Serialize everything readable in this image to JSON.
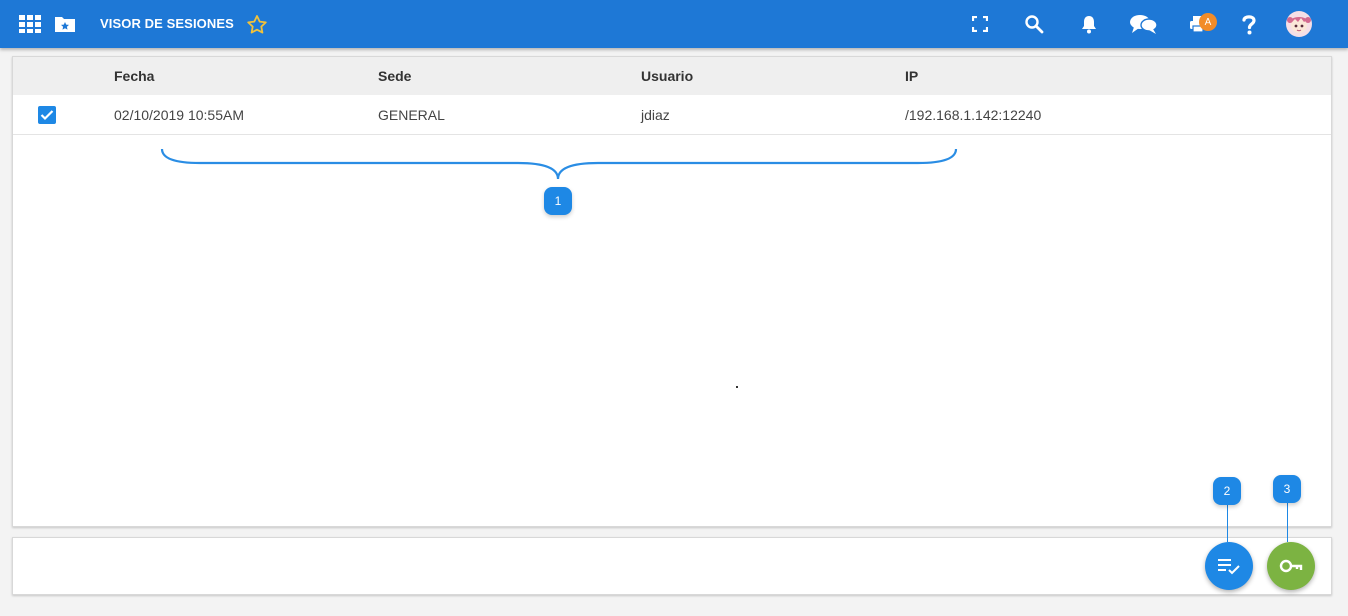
{
  "header": {
    "title": "VISOR DE SESIONES",
    "badge_letter": "A",
    "icons": [
      "apps-grid-icon",
      "folder-star-icon",
      "star-outline-icon",
      "fullscreen-icon",
      "search-icon",
      "bell-icon",
      "chat-icon",
      "print-icon",
      "help-icon",
      "user-avatar"
    ]
  },
  "table": {
    "columns": [
      "Fecha",
      "Sede",
      "Usuario",
      "IP"
    ],
    "rows": [
      {
        "checked": true,
        "fecha": "02/10/2019 10:55AM",
        "sede": "GENERAL",
        "usuario": "jdiaz",
        "ip": "/192.168.1.142:12240"
      }
    ]
  },
  "annotations": {
    "brace_marker": "1",
    "marker_2": "2",
    "marker_3": "3"
  },
  "actions": [
    {
      "icon": "list-check-icon",
      "color": "#1e88e5"
    },
    {
      "icon": "key-icon",
      "color": "#7cb342"
    }
  ],
  "colors": {
    "topbar": "#1e78d6",
    "accent": "#1e88e5",
    "star": "#f2c23a",
    "badge": "#f28c28",
    "key_fab": "#7cb342"
  }
}
